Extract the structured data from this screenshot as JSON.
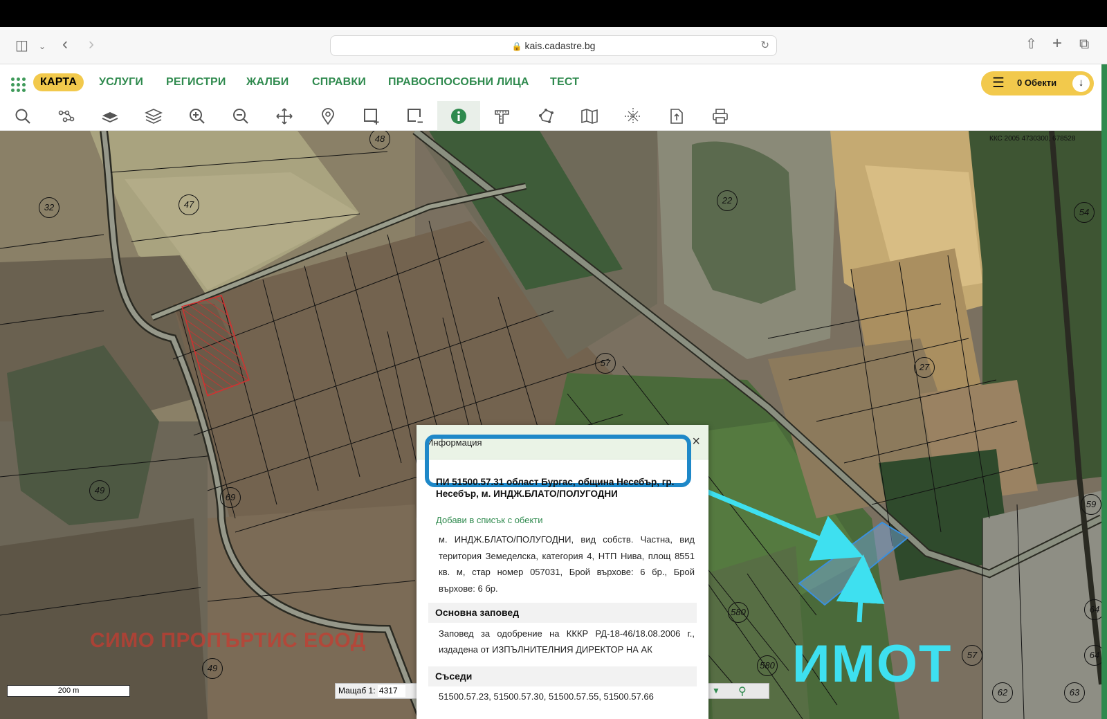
{
  "browser": {
    "url": "kais.cadastre.bg"
  },
  "nav": {
    "items": [
      "КАРТА",
      "УСЛУГИ",
      "РЕГИСТРИ",
      "ЖАЛБИ",
      "СПРАВКИ",
      "ПРАВОСПОСОБНИ ЛИЦА",
      "ТЕСТ"
    ],
    "objects_label": "0 Обекти"
  },
  "toolbar": {
    "tools": [
      "search-icon",
      "network-icon",
      "layer-icon",
      "layers-stack-icon",
      "zoom-in-icon",
      "zoom-out-icon",
      "pan-icon",
      "location-pin-icon",
      "select-rect-add-icon",
      "select-rect-remove-icon",
      "info-icon",
      "measure-icon",
      "polygon-icon",
      "map-icon",
      "crosshair-icon",
      "export-icon",
      "print-icon"
    ],
    "active": "info-icon"
  },
  "map": {
    "coord_readout": "ККС 2005 4730300, 678528",
    "labels": [
      "48",
      "47",
      "32",
      "22",
      "54",
      "57",
      "27",
      "49",
      "69",
      "59",
      "580",
      "580",
      "64",
      "57",
      "64",
      "49",
      "62",
      "63"
    ],
    "watermark": "СИМО ПРОПЪРТИС ЕООД",
    "annotation": "ИМОТ",
    "scalebar": "200 m",
    "scale_label": "Мащаб 1:",
    "scale_value": "4317"
  },
  "info": {
    "title": "Информация",
    "close": "×",
    "pi": "ПИ 51500.57.31 област Бургас, община Несебър, гр. Несебър, м. ИНДЖ.БЛАТО/ПОЛУГОДНИ",
    "add_link": "Добави в списък с обекти",
    "description": "м. ИНДЖ.БЛАТО/ПОЛУГОДНИ, вид собств. Частна, вид територия Земеделска, категория 4, НТП Нива, площ 8551 кв. м, стар номер 057031, Брой върхове: 6 бр., Брой върхове: 6 бр.",
    "order_head": "Основна заповед",
    "order_text": "Заповед за одобрение на КККР РД-18-46/18.08.2006 г., издадена от ИЗПЪЛНИТЕЛНИЯ ДИРЕКТОР НА АК",
    "neighbors_head": "Съседи",
    "neighbors_text": "51500.57.23, 51500.57.30, 51500.57.55, 51500.57.66"
  },
  "colors": {
    "accent_green": "#2f8a4e",
    "accent_yellow": "#f2c94c",
    "highlight_blue": "#1e88c8",
    "arrow_cyan": "#3ee0f0"
  }
}
